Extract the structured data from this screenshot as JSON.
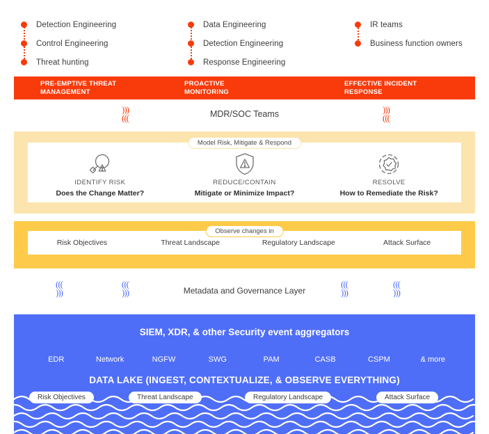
{
  "roles": {
    "columns": [
      {
        "items": [
          "Detection Engineering",
          "Control Engineering",
          "Threat hunting"
        ]
      },
      {
        "items": [
          "Data Engineering",
          "Detection Engineering",
          "Response Engineering"
        ]
      },
      {
        "items": [
          "IR teams",
          "Business function owners"
        ]
      }
    ]
  },
  "banner": {
    "segments": [
      "PRE-EMPTIVE THREAT\nMANAGEMENT",
      "PROACTIVE\nMONITORING",
      "EFFECTIVE INCIDENT\nRESPONSE"
    ],
    "seg1_line1": "PRE-EMPTIVE THREAT",
    "seg1_line2": "MANAGEMENT",
    "seg2_line1": "PROACTIVE",
    "seg2_line2": "MONITORING",
    "seg3_line1": "EFFECTIVE INCIDENT",
    "seg3_line2": "RESPONSE"
  },
  "mdr": {
    "label": "MDR/SOC Teams"
  },
  "model_band": {
    "pill": "Model Risk, Mitigate & Respond",
    "columns": [
      {
        "icon": "magnifier-warning-icon",
        "title": "IDENTIFY RISK",
        "question": "Does the Change Matter?"
      },
      {
        "icon": "shield-warning-icon",
        "title": "REDUCE/CONTAIN",
        "question": "Mitigate or Minimize Impact?"
      },
      {
        "icon": "check-badge-icon",
        "title": "RESOLVE",
        "question": "How to Remediate the Risk?"
      }
    ]
  },
  "observe_band": {
    "pill": "Observe changes in",
    "items": [
      "Risk Objectives",
      "Threat Landscape",
      "Regulatory Landscape",
      "Attack Surface"
    ]
  },
  "metadata": {
    "label": "Metadata and Governance Layer"
  },
  "data_lake": {
    "title": "SIEM, XDR, & other Security event aggregators",
    "tools": [
      "EDR",
      "Network",
      "NGFW",
      "SWG",
      "PAM",
      "CASB",
      "CSPM",
      "& more"
    ],
    "subtitle": "DATA LAKE (INGEST, CONTEXTUALIZE, & OBSERVE EVERYTHING)",
    "wave_pills": [
      "Risk Objectives",
      "Threat Landscape",
      "Regulatory Landscape",
      "Attack Surface"
    ]
  },
  "colors": {
    "red": "#F93A0A",
    "cream": "#FBE4AE",
    "yellow": "#FDCB49",
    "blue": "#4F6EF7",
    "text": "#3b3b3b"
  },
  "wiggle_glyph": {
    "top": ")))",
    "bottom": "((("
  }
}
